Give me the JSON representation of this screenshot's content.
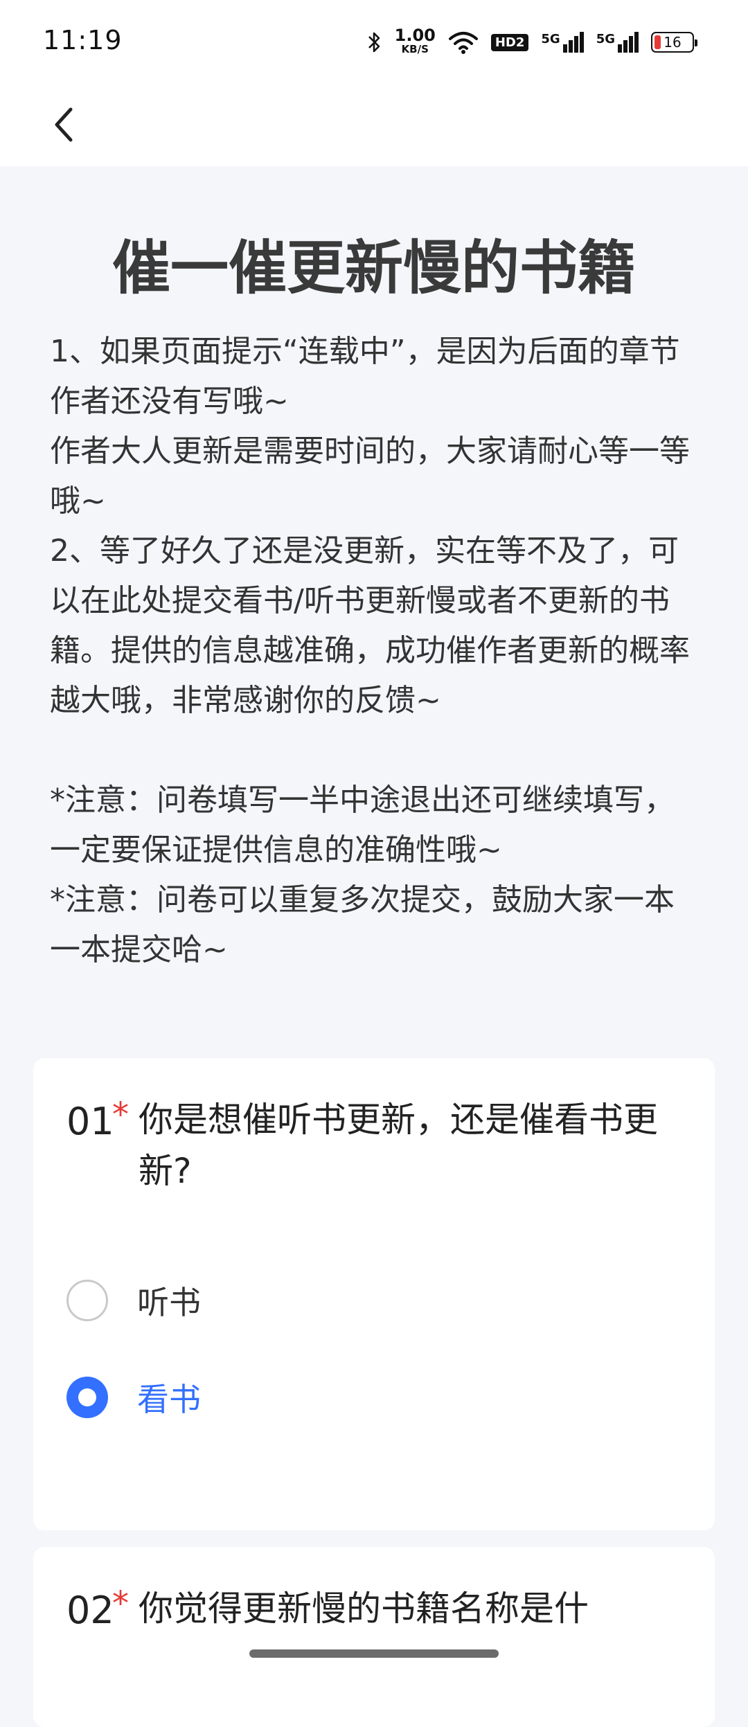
{
  "status_bar": {
    "time": "11:19",
    "net_speed_value": "1.00",
    "net_speed_unit": "KB/S",
    "hd_badge": "HD2",
    "signal1_label": "5G",
    "signal2_label": "5G",
    "battery_level": "16"
  },
  "nav": {
    "back_icon": "chevron-left-icon"
  },
  "page": {
    "title": "催一催更新慢的书籍",
    "intro": "1、如果页面提示“连载中”，是因为后面的章节作者还没有写哦~\n作者大人更新是需要时间的，大家请耐心等一等哦~\n2、等了好久了还是没更新，实在等不及了，可以在此处提交看书/听书更新慢或者不更新的书籍。提供的信息越准确，成功催作者更新的概率越大哦，非常感谢你的反馈~\n\n*注意：问卷填写一半中途退出还可继续填写，一定要保证提供信息的准确性哦~\n*注意：问卷可以重复多次提交，鼓励大家一本一本提交哈~"
  },
  "questions": [
    {
      "number": "01",
      "required_mark": "*",
      "text": "你是想催听书更新，还是催看书更新?",
      "options": [
        {
          "label": "听书",
          "selected": false
        },
        {
          "label": "看书",
          "selected": true
        }
      ]
    },
    {
      "number": "02",
      "required_mark": "*",
      "text": "你觉得更新慢的书籍名称是什"
    }
  ],
  "colors": {
    "accent": "#3370FF",
    "required": "#E53935",
    "background": "#F4F6FA"
  }
}
